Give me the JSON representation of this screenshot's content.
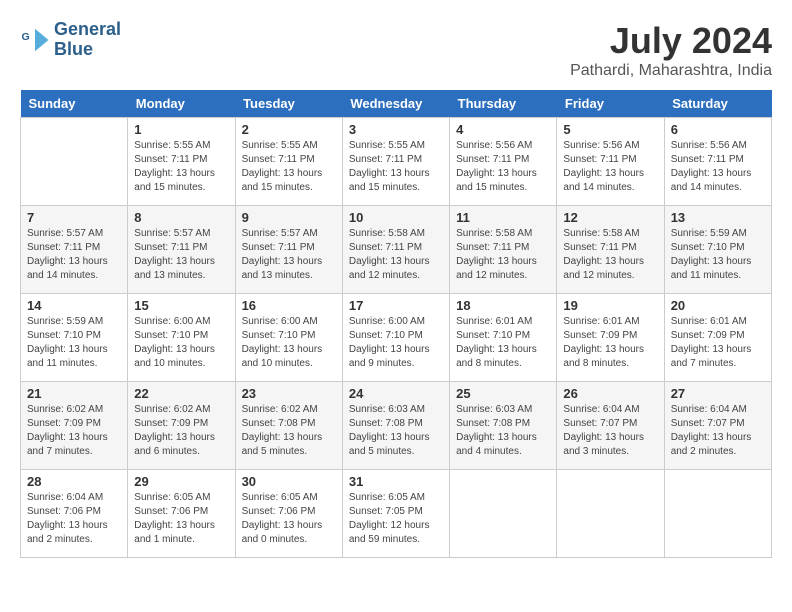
{
  "header": {
    "logo_line1": "General",
    "logo_line2": "Blue",
    "month": "July 2024",
    "location": "Pathardi, Maharashtra, India"
  },
  "days_of_week": [
    "Sunday",
    "Monday",
    "Tuesday",
    "Wednesday",
    "Thursday",
    "Friday",
    "Saturday"
  ],
  "weeks": [
    [
      {
        "day": "",
        "info": ""
      },
      {
        "day": "1",
        "info": "Sunrise: 5:55 AM\nSunset: 7:11 PM\nDaylight: 13 hours\nand 15 minutes."
      },
      {
        "day": "2",
        "info": "Sunrise: 5:55 AM\nSunset: 7:11 PM\nDaylight: 13 hours\nand 15 minutes."
      },
      {
        "day": "3",
        "info": "Sunrise: 5:55 AM\nSunset: 7:11 PM\nDaylight: 13 hours\nand 15 minutes."
      },
      {
        "day": "4",
        "info": "Sunrise: 5:56 AM\nSunset: 7:11 PM\nDaylight: 13 hours\nand 15 minutes."
      },
      {
        "day": "5",
        "info": "Sunrise: 5:56 AM\nSunset: 7:11 PM\nDaylight: 13 hours\nand 14 minutes."
      },
      {
        "day": "6",
        "info": "Sunrise: 5:56 AM\nSunset: 7:11 PM\nDaylight: 13 hours\nand 14 minutes."
      }
    ],
    [
      {
        "day": "7",
        "info": "Sunrise: 5:57 AM\nSunset: 7:11 PM\nDaylight: 13 hours\nand 14 minutes."
      },
      {
        "day": "8",
        "info": "Sunrise: 5:57 AM\nSunset: 7:11 PM\nDaylight: 13 hours\nand 13 minutes."
      },
      {
        "day": "9",
        "info": "Sunrise: 5:57 AM\nSunset: 7:11 PM\nDaylight: 13 hours\nand 13 minutes."
      },
      {
        "day": "10",
        "info": "Sunrise: 5:58 AM\nSunset: 7:11 PM\nDaylight: 13 hours\nand 12 minutes."
      },
      {
        "day": "11",
        "info": "Sunrise: 5:58 AM\nSunset: 7:11 PM\nDaylight: 13 hours\nand 12 minutes."
      },
      {
        "day": "12",
        "info": "Sunrise: 5:58 AM\nSunset: 7:11 PM\nDaylight: 13 hours\nand 12 minutes."
      },
      {
        "day": "13",
        "info": "Sunrise: 5:59 AM\nSunset: 7:10 PM\nDaylight: 13 hours\nand 11 minutes."
      }
    ],
    [
      {
        "day": "14",
        "info": "Sunrise: 5:59 AM\nSunset: 7:10 PM\nDaylight: 13 hours\nand 11 minutes."
      },
      {
        "day": "15",
        "info": "Sunrise: 6:00 AM\nSunset: 7:10 PM\nDaylight: 13 hours\nand 10 minutes."
      },
      {
        "day": "16",
        "info": "Sunrise: 6:00 AM\nSunset: 7:10 PM\nDaylight: 13 hours\nand 10 minutes."
      },
      {
        "day": "17",
        "info": "Sunrise: 6:00 AM\nSunset: 7:10 PM\nDaylight: 13 hours\nand 9 minutes."
      },
      {
        "day": "18",
        "info": "Sunrise: 6:01 AM\nSunset: 7:10 PM\nDaylight: 13 hours\nand 8 minutes."
      },
      {
        "day": "19",
        "info": "Sunrise: 6:01 AM\nSunset: 7:09 PM\nDaylight: 13 hours\nand 8 minutes."
      },
      {
        "day": "20",
        "info": "Sunrise: 6:01 AM\nSunset: 7:09 PM\nDaylight: 13 hours\nand 7 minutes."
      }
    ],
    [
      {
        "day": "21",
        "info": "Sunrise: 6:02 AM\nSunset: 7:09 PM\nDaylight: 13 hours\nand 7 minutes."
      },
      {
        "day": "22",
        "info": "Sunrise: 6:02 AM\nSunset: 7:09 PM\nDaylight: 13 hours\nand 6 minutes."
      },
      {
        "day": "23",
        "info": "Sunrise: 6:02 AM\nSunset: 7:08 PM\nDaylight: 13 hours\nand 5 minutes."
      },
      {
        "day": "24",
        "info": "Sunrise: 6:03 AM\nSunset: 7:08 PM\nDaylight: 13 hours\nand 5 minutes."
      },
      {
        "day": "25",
        "info": "Sunrise: 6:03 AM\nSunset: 7:08 PM\nDaylight: 13 hours\nand 4 minutes."
      },
      {
        "day": "26",
        "info": "Sunrise: 6:04 AM\nSunset: 7:07 PM\nDaylight: 13 hours\nand 3 minutes."
      },
      {
        "day": "27",
        "info": "Sunrise: 6:04 AM\nSunset: 7:07 PM\nDaylight: 13 hours\nand 2 minutes."
      }
    ],
    [
      {
        "day": "28",
        "info": "Sunrise: 6:04 AM\nSunset: 7:06 PM\nDaylight: 13 hours\nand 2 minutes."
      },
      {
        "day": "29",
        "info": "Sunrise: 6:05 AM\nSunset: 7:06 PM\nDaylight: 13 hours\nand 1 minute."
      },
      {
        "day": "30",
        "info": "Sunrise: 6:05 AM\nSunset: 7:06 PM\nDaylight: 13 hours\nand 0 minutes."
      },
      {
        "day": "31",
        "info": "Sunrise: 6:05 AM\nSunset: 7:05 PM\nDaylight: 12 hours\nand 59 minutes."
      },
      {
        "day": "",
        "info": ""
      },
      {
        "day": "",
        "info": ""
      },
      {
        "day": "",
        "info": ""
      }
    ]
  ]
}
